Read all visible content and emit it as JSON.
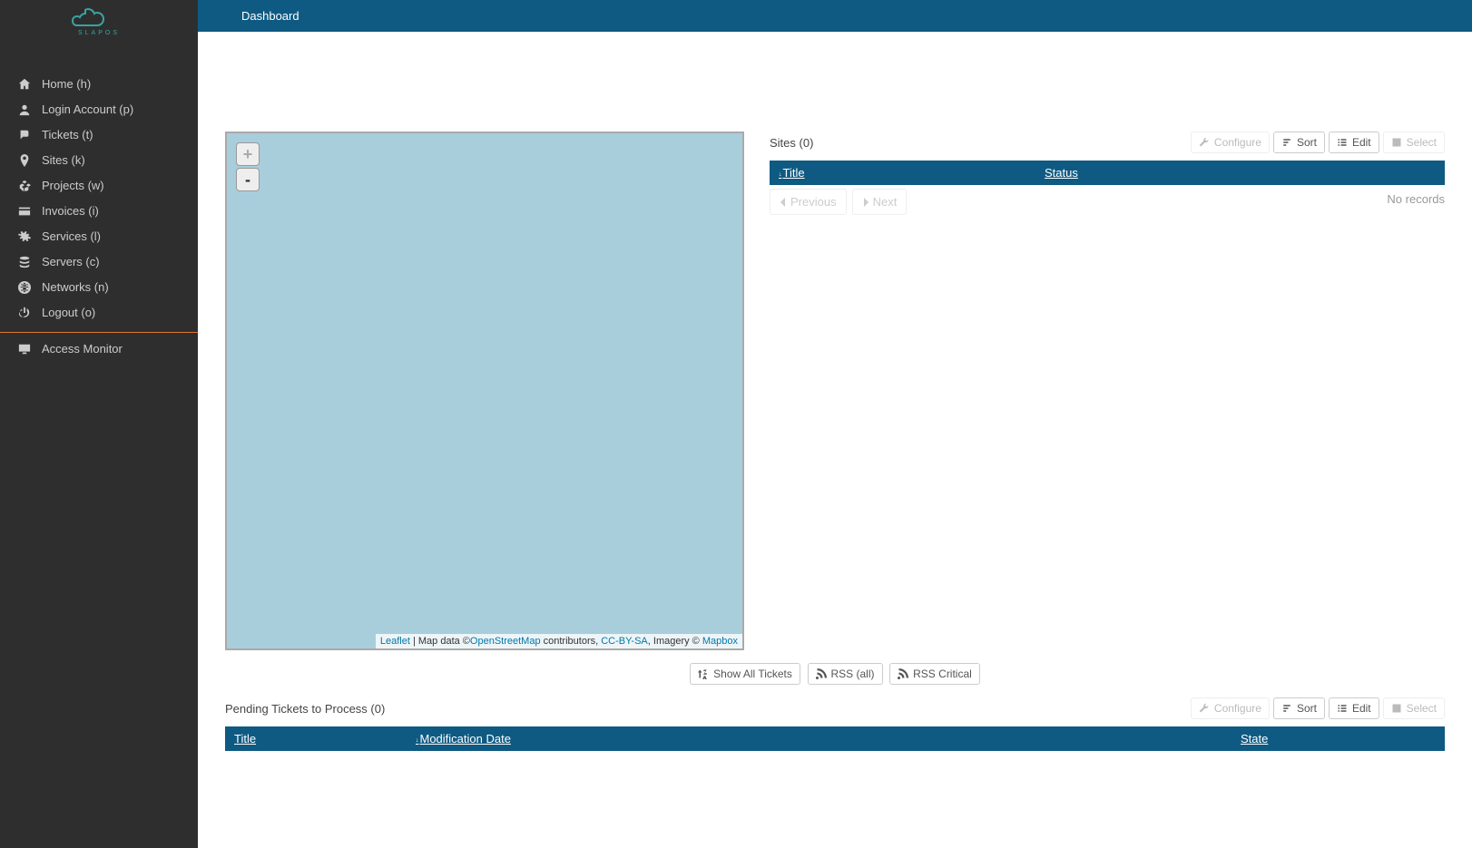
{
  "brand": {
    "name": "SLAPOS"
  },
  "topbar": {
    "title": "Dashboard"
  },
  "sidebar": {
    "items": [
      {
        "label": "Home (h)",
        "icon": "home"
      },
      {
        "label": "Login Account (p)",
        "icon": "user"
      },
      {
        "label": "Tickets (t)",
        "icon": "comments"
      },
      {
        "label": "Sites (k)",
        "icon": "marker"
      },
      {
        "label": "Projects (w)",
        "icon": "cubes"
      },
      {
        "label": "Invoices (i)",
        "icon": "card"
      },
      {
        "label": "Services (l)",
        "icon": "cogs"
      },
      {
        "label": "Servers (c)",
        "icon": "database"
      },
      {
        "label": "Networks (n)",
        "icon": "globe"
      },
      {
        "label": "Logout (o)",
        "icon": "power"
      }
    ],
    "extra": {
      "label": "Access Monitor",
      "icon": "desktop"
    }
  },
  "map": {
    "zoom_in": "+",
    "zoom_out": "-",
    "attr": {
      "leaflet": "Leaflet",
      "map_data_prefix": " | Map data ©",
      "osm": "OpenStreetMap",
      "contrib": " contributors, ",
      "cc": "CC-BY-SA",
      "imagery": ", Imagery © ",
      "mapbox": "Mapbox"
    }
  },
  "sites": {
    "title": "Sites (0)",
    "toolbar": {
      "configure": "Configure",
      "sort": "Sort",
      "edit": "Edit",
      "select": "Select"
    },
    "cols": {
      "title": "Title",
      "status": "Status"
    },
    "no_records": "No records",
    "prev": "Previous",
    "next": "Next"
  },
  "ticket_buttons": {
    "show_all": "Show All Tickets",
    "rss_all": "RSS (all)",
    "rss_critical": "RSS Critical"
  },
  "tickets": {
    "title": "Pending Tickets to Process (0)",
    "toolbar": {
      "configure": "Configure",
      "sort": "Sort",
      "edit": "Edit",
      "select": "Select"
    },
    "cols": {
      "title": "Title",
      "mod": "Modification Date",
      "state": "State"
    }
  }
}
